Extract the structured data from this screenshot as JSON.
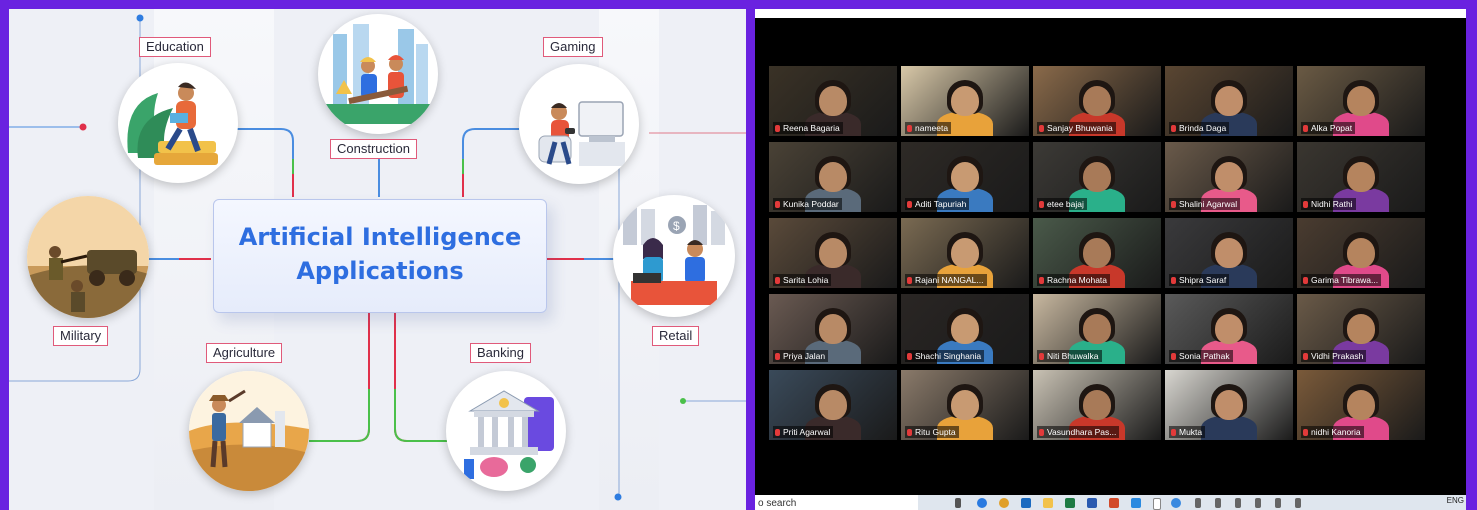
{
  "left_panel": {
    "title_line1": "Artificial Intelligence",
    "title_line2": "Applications",
    "labels": {
      "education": "Education",
      "construction": "Construction",
      "gaming": "Gaming",
      "military": "Military",
      "retail": "Retail",
      "agriculture": "Agriculture",
      "banking": "Banking"
    },
    "colors": {
      "title": "#2e6ee0",
      "label_border": "#e05a7a",
      "frame": "#6a22e0"
    }
  },
  "zoom": {
    "participants": [
      {
        "name": "Reena Bagaria"
      },
      {
        "name": "nameeta"
      },
      {
        "name": "Sanjay Bhuwania",
        "active": true
      },
      {
        "name": "Brinda Daga"
      },
      {
        "name": "Alka Popat"
      },
      {
        "name": "Kunika Poddar"
      },
      {
        "name": "Aditi Tapuriah"
      },
      {
        "name": "etee bajaj"
      },
      {
        "name": "Shalini Agarwal"
      },
      {
        "name": "Nidhi Rathi"
      },
      {
        "name": "Sarita Lohia"
      },
      {
        "name": "Rajani NANGAL..."
      },
      {
        "name": "Rachna Mohata"
      },
      {
        "name": "Shipra Saraf"
      },
      {
        "name": "Garima Tibrawa..."
      },
      {
        "name": "Priya Jalan"
      },
      {
        "name": "Shachi Singhania"
      },
      {
        "name": "Niti Bhuwalka"
      },
      {
        "name": "Sonia Pathak"
      },
      {
        "name": "Vidhi Prakash"
      },
      {
        "name": "Priti Agarwal"
      },
      {
        "name": "Ritu Gupta"
      },
      {
        "name": "Vasundhara Pas..."
      },
      {
        "name": "Mukta"
      },
      {
        "name": "nidhi Kanoria"
      }
    ],
    "taskbar": {
      "search_text": "o search",
      "lang": "ENG"
    },
    "colors": {
      "active_outline": "#c8e03a",
      "mic_muted": "#e23a3a"
    }
  }
}
